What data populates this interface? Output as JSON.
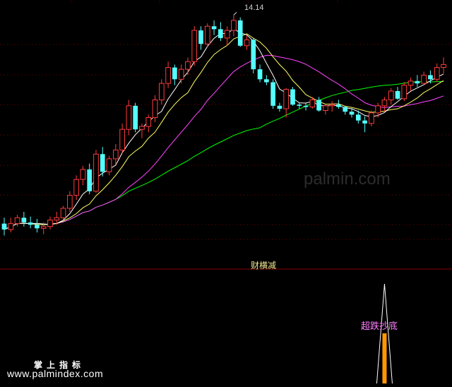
{
  "chart_data": [
    {
      "type": "candlestick",
      "panel": "main",
      "peak_label": "14.14",
      "colors": {
        "up": "#ff3b3b",
        "down": "#54ffff",
        "ma5": "#ffffff",
        "ma10": "#ffff66",
        "ma20": "#ff44ff",
        "ma60": "#00ff00"
      },
      "candles": [
        [
          10.6,
          10.7,
          10.4,
          10.5
        ],
        [
          10.5,
          10.7,
          10.45,
          10.6
        ],
        [
          10.6,
          10.75,
          10.55,
          10.7
        ],
        [
          10.7,
          10.8,
          10.55,
          10.62
        ],
        [
          10.62,
          10.72,
          10.52,
          10.58
        ],
        [
          10.58,
          10.68,
          10.45,
          10.52
        ],
        [
          10.52,
          10.62,
          10.42,
          10.55
        ],
        [
          10.55,
          10.72,
          10.5,
          10.66
        ],
        [
          10.66,
          10.8,
          10.58,
          10.7
        ],
        [
          10.7,
          10.9,
          10.65,
          10.86
        ],
        [
          10.86,
          11.15,
          10.8,
          11.08
        ],
        [
          11.08,
          11.42,
          11.0,
          11.35
        ],
        [
          11.35,
          11.58,
          11.25,
          11.52
        ],
        [
          11.52,
          11.62,
          11.1,
          11.15
        ],
        [
          11.15,
          11.85,
          11.12,
          11.78
        ],
        [
          11.78,
          11.9,
          11.4,
          11.48
        ],
        [
          11.48,
          11.75,
          11.42,
          11.7
        ],
        [
          11.7,
          11.95,
          11.6,
          11.85
        ],
        [
          11.85,
          12.3,
          11.8,
          12.2
        ],
        [
          12.2,
          12.7,
          12.1,
          12.6
        ],
        [
          12.6,
          12.65,
          12.15,
          12.2
        ],
        [
          12.2,
          12.3,
          12.05,
          12.25
        ],
        [
          12.25,
          12.45,
          12.15,
          12.4
        ],
        [
          12.4,
          12.78,
          12.32,
          12.7
        ],
        [
          12.7,
          13.05,
          12.62,
          12.98
        ],
        [
          12.98,
          13.35,
          12.9,
          13.25
        ],
        [
          13.25,
          13.3,
          12.95,
          13.05
        ],
        [
          13.05,
          13.3,
          12.98,
          13.22
        ],
        [
          13.22,
          13.42,
          13.12,
          13.35
        ],
        [
          13.35,
          13.95,
          13.28,
          13.88
        ],
        [
          13.88,
          13.95,
          13.55,
          13.65
        ],
        [
          13.65,
          14.0,
          13.6,
          13.95
        ],
        [
          13.95,
          14.05,
          13.8,
          13.9
        ],
        [
          13.9,
          14.02,
          13.7,
          13.75
        ],
        [
          13.75,
          13.95,
          13.62,
          13.88
        ],
        [
          13.88,
          14.14,
          13.78,
          14.05
        ],
        [
          14.05,
          14.1,
          13.6,
          13.62
        ],
        [
          13.62,
          13.8,
          13.55,
          13.72
        ],
        [
          13.72,
          13.75,
          13.15,
          13.22
        ],
        [
          13.22,
          13.3,
          13.0,
          13.05
        ],
        [
          13.05,
          13.12,
          12.95,
          13.0
        ],
        [
          13.0,
          13.05,
          12.55,
          12.6
        ],
        [
          12.6,
          12.65,
          12.5,
          12.55
        ],
        [
          12.55,
          12.9,
          12.4,
          12.88
        ],
        [
          12.88,
          12.92,
          12.6,
          12.62
        ],
        [
          12.62,
          12.66,
          12.55,
          12.6
        ],
        [
          12.6,
          12.64,
          12.52,
          12.58
        ],
        [
          12.58,
          12.75,
          12.55,
          12.7
        ],
        [
          12.7,
          12.75,
          12.5,
          12.52
        ],
        [
          12.52,
          12.62,
          12.45,
          12.6
        ],
        [
          12.6,
          12.68,
          12.5,
          12.62
        ],
        [
          12.62,
          12.7,
          12.55,
          12.58
        ],
        [
          12.58,
          12.6,
          12.45,
          12.5
        ],
        [
          12.5,
          12.56,
          12.4,
          12.45
        ],
        [
          12.45,
          12.52,
          12.3,
          12.35
        ],
        [
          12.35,
          12.42,
          12.15,
          12.3
        ],
        [
          12.3,
          12.52,
          12.25,
          12.48
        ],
        [
          12.48,
          12.65,
          12.4,
          12.6
        ],
        [
          12.6,
          12.75,
          12.5,
          12.7
        ],
        [
          12.7,
          12.9,
          12.62,
          12.85
        ],
        [
          12.85,
          12.92,
          12.7,
          12.72
        ],
        [
          12.72,
          13.0,
          12.68,
          12.95
        ],
        [
          12.95,
          13.08,
          12.85,
          13.02
        ],
        [
          13.02,
          13.12,
          12.92,
          12.98
        ],
        [
          12.98,
          13.18,
          12.95,
          13.12
        ],
        [
          13.12,
          13.2,
          12.98,
          13.05
        ],
        [
          13.05,
          13.32,
          13.0,
          13.25
        ],
        [
          13.25,
          13.42,
          13.15,
          13.3
        ]
      ]
    },
    {
      "type": "bar",
      "panel": "indicator",
      "title": "财横减",
      "signal_label": "超跌抄底",
      "colors": {
        "bar": "#ff9900",
        "spike": "#ffffff"
      },
      "signal_index": 58,
      "values": [
        1
      ]
    }
  ],
  "watermark": {
    "cn": "掌上指标",
    "url": "www.palmindex.com",
    "faint": "palmin.com"
  }
}
